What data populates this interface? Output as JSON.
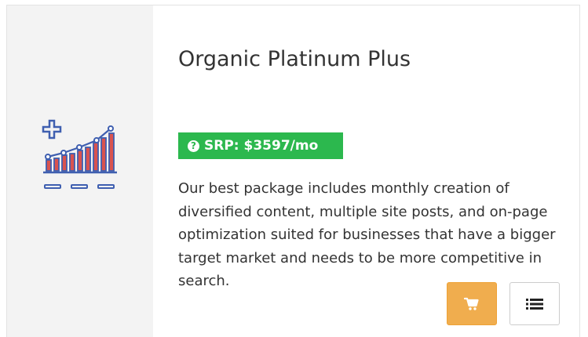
{
  "product": {
    "title": "Organic Platinum Plus",
    "srp_label": "SRP: $3597/mo",
    "description": "Our best package includes monthly creation of diversified content, multiple site posts, and on-page optimization suited for businesses that have a bigger target market and needs to be more competitive in search."
  },
  "icons": {
    "product": "growth-chart-icon",
    "help": "question-circle-icon",
    "cart": "shopping-cart-icon",
    "details": "list-icon"
  },
  "colors": {
    "left_panel": "#f3f3f3",
    "srp_badge": "#2cb84e",
    "cart_button": "#f0ad4e",
    "chart_blue": "#3f5fb0",
    "chart_red": "#d9534f"
  }
}
